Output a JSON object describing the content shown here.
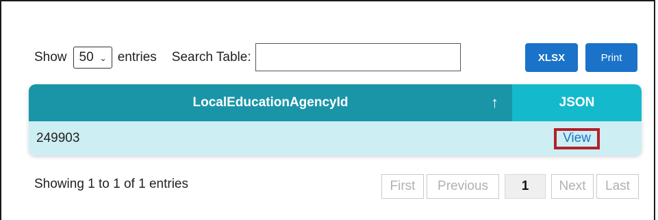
{
  "controls": {
    "show_label": "Show",
    "page_size": "50",
    "entries_label": "entries",
    "search_label": "Search Table:",
    "search_value": ""
  },
  "buttons": {
    "xlsx": "XLSX",
    "print": "Print"
  },
  "table": {
    "columns": [
      "LocalEducationAgencyId",
      "JSON"
    ],
    "sort_indicator": "↑",
    "rows": [
      {
        "id": "249903",
        "link": "View"
      }
    ]
  },
  "info": "Showing 1 to 1 of 1 entries",
  "pagination": {
    "first": "First",
    "previous": "Previous",
    "current": "1",
    "next": "Next",
    "last": "Last"
  },
  "colors": {
    "button_blue": "#1a73c8",
    "header_teal": "#1a95a8",
    "header_cyan": "#15b9cc",
    "row_bg": "#cdeef3",
    "highlight_red": "#b3202b"
  }
}
